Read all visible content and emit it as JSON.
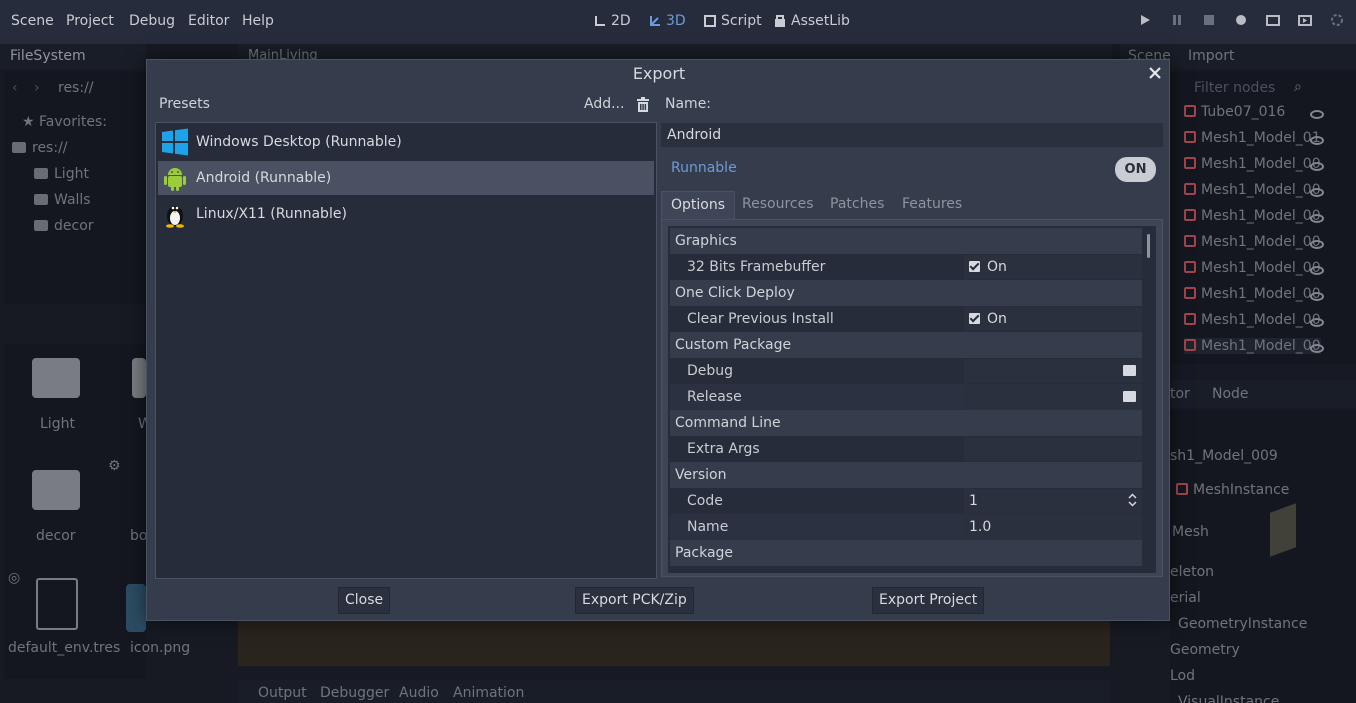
{
  "menu": {
    "items": [
      "Scene",
      "Project",
      "Debug",
      "Editor",
      "Help"
    ]
  },
  "workspaces": {
    "w2d": "2D",
    "w3d": "3D",
    "script": "Script",
    "assetlib": "AssetLib"
  },
  "filesystem": {
    "tab": "FileSystem",
    "path": "res://",
    "favorites": "Favorites:",
    "tree": [
      "res://",
      "Light",
      "Walls",
      "decor"
    ],
    "grid": [
      "Light",
      "W",
      "decor",
      "bo",
      "default_env.tres",
      "icon.png"
    ]
  },
  "viewport": {
    "tab": "MainLiving",
    "bottom_tabs": [
      "Output",
      "Debugger",
      "Audio",
      "Animation"
    ]
  },
  "scene_dock": {
    "tabs": [
      "Scene",
      "Import"
    ],
    "filter_placeholder": "Filter nodes",
    "nodes": [
      "Tube07_016",
      "Mesh1_Model_01",
      "Mesh1_Model_00",
      "Mesh1_Model_00",
      "Mesh1_Model_00",
      "Mesh1_Model_00",
      "Mesh1_Model_00",
      "Mesh1_Model_00",
      "Mesh1_Model_00",
      "Mesh1_Model_00"
    ]
  },
  "inspector_dock": {
    "tabs": [
      "tor",
      "Node"
    ],
    "object": "sh1_Model_009",
    "type": "MeshInstance",
    "mesh_label": "Mesh",
    "items": [
      "eleton",
      "erial",
      "GeometryInstance",
      "Geometry",
      "Lod",
      "VisualInstance"
    ]
  },
  "dialog": {
    "title": "Export",
    "presets_label": "Presets",
    "add_label": "Add...",
    "name_label": "Name:",
    "presets": [
      {
        "label": "Windows Desktop (Runnable)",
        "icon": "windows-icon"
      },
      {
        "label": "Android (Runnable)",
        "icon": "android-icon"
      },
      {
        "label": "Linux/X11 (Runnable)",
        "icon": "linux-icon"
      }
    ],
    "name_value": "Android",
    "runnable_label": "Runnable",
    "runnable_toggle": "ON",
    "tabs": [
      "Options",
      "Resources",
      "Patches",
      "Features"
    ],
    "options": {
      "graphics": "Graphics",
      "fb32_label": "32 Bits Framebuffer",
      "fb32_value": "On",
      "ocd": "One Click Deploy",
      "clear_label": "Clear Previous Install",
      "clear_value": "On",
      "custom_pkg": "Custom Package",
      "debug_label": "Debug",
      "release_label": "Release",
      "cmdline": "Command Line",
      "extra_label": "Extra Args",
      "version": "Version",
      "code_label": "Code",
      "code_value": "1",
      "name_label": "Name",
      "name_value": "1.0",
      "package": "Package"
    },
    "buttons": {
      "close": "Close",
      "export_pck": "Export PCK/Zip",
      "export_project": "Export Project"
    }
  },
  "colors": {
    "accent": "#6c9bd9",
    "background": "#202531",
    "dialog": "#353c4c"
  }
}
